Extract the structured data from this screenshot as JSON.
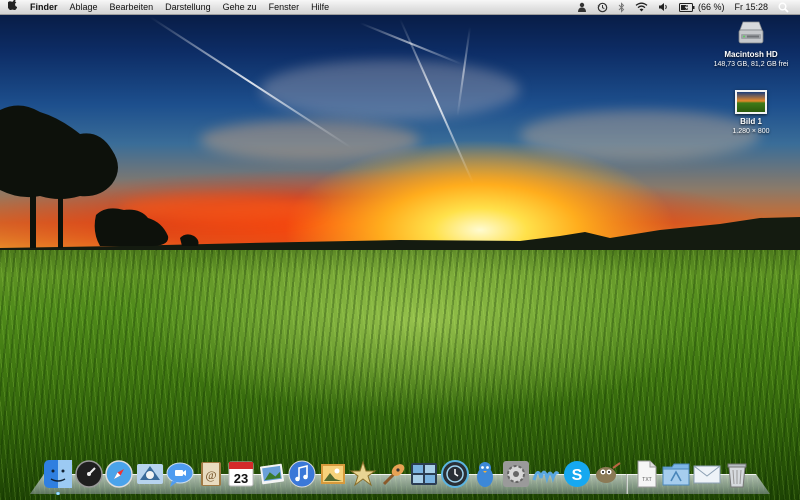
{
  "menubar": {
    "apple_icon": "apple-logo",
    "app_name": "Finder",
    "menus": [
      "Ablage",
      "Bearbeiten",
      "Darstellung",
      "Gehe zu",
      "Fenster",
      "Hilfe"
    ],
    "status": {
      "icons": [
        "user-icon",
        "time-machine-icon",
        "bluetooth-icon",
        "wifi-icon",
        "volume-icon",
        "battery-icon"
      ],
      "battery_text": "(66 %)",
      "battery_level": 0.66,
      "clock": "Fr 15:28",
      "spotlight_icon": "spotlight-search-icon"
    }
  },
  "desktop": {
    "icons": [
      {
        "label": "Macintosh HD",
        "sub": "148,73 GB, 81,2 GB frei",
        "icon": "hard-disk-icon"
      },
      {
        "label": "Bild 1",
        "sub": "1.280 × 800",
        "icon": "image-file-icon"
      }
    ]
  },
  "dock": {
    "apps": [
      {
        "name": "Finder",
        "icon": "finder-icon",
        "running": true,
        "color": "#3b8ce8"
      },
      {
        "name": "Dashboard",
        "icon": "dashboard-icon",
        "running": false,
        "color": "#2a2a2a"
      },
      {
        "name": "Safari",
        "icon": "safari-icon",
        "running": false,
        "color": "#4aa3ea"
      },
      {
        "name": "Mail",
        "icon": "mail-icon",
        "running": false,
        "color": "#9ac3e8"
      },
      {
        "name": "iChat",
        "icon": "ichat-icon",
        "running": false,
        "color": "#4f9cf0"
      },
      {
        "name": "Adressbuch",
        "icon": "address-book-icon",
        "running": false,
        "color": "#a07a44"
      },
      {
        "name": "iCal",
        "icon": "ical-icon",
        "running": false,
        "color": "#ffffff",
        "day": "23"
      },
      {
        "name": "iPhoto",
        "icon": "iphoto-icon",
        "running": false,
        "color": "#b0c6dd"
      },
      {
        "name": "iTunes",
        "icon": "itunes-icon",
        "running": false,
        "color": "#3b78d8"
      },
      {
        "name": "Vorschau",
        "icon": "preview-icon",
        "running": false,
        "color": "#d79a3c"
      },
      {
        "name": "iMovie",
        "icon": "imovie-icon",
        "running": false,
        "color": "#c4ad6e"
      },
      {
        "name": "GarageBand",
        "icon": "garageband-icon",
        "running": false,
        "color": "#e8a254"
      },
      {
        "name": "Spaces",
        "icon": "spaces-icon",
        "running": false,
        "color": "#3a5470"
      },
      {
        "name": "Time Machine",
        "icon": "time-machine-icon",
        "running": false,
        "color": "#2f6f8f"
      },
      {
        "name": "Adium",
        "icon": "adium-icon",
        "running": false,
        "color": "#3d88d8"
      },
      {
        "name": "Systemeinstellungen",
        "icon": "system-preferences-icon",
        "running": false,
        "color": "#8a8a8a"
      },
      {
        "name": "Handwriting",
        "icon": "handwriting-icon",
        "running": false,
        "color": "#5aa7e0"
      },
      {
        "name": "Skype",
        "icon": "skype-icon",
        "running": false,
        "color": "#16a8f0"
      },
      {
        "name": "GIMP",
        "icon": "gimp-icon",
        "running": false,
        "color": "#8b7a55"
      }
    ],
    "stacks": [
      {
        "name": "Dokument",
        "icon": "text-document-icon",
        "color": "#f4f4f4",
        "badge": "TXT"
      },
      {
        "name": "Programme",
        "icon": "applications-folder-icon",
        "color": "#7eb6e6"
      },
      {
        "name": "Briefumschlag",
        "icon": "envelope-icon",
        "color": "#e8eef4"
      },
      {
        "name": "Papierkorb",
        "icon": "trash-icon",
        "color": "#c8ccd0"
      }
    ]
  }
}
